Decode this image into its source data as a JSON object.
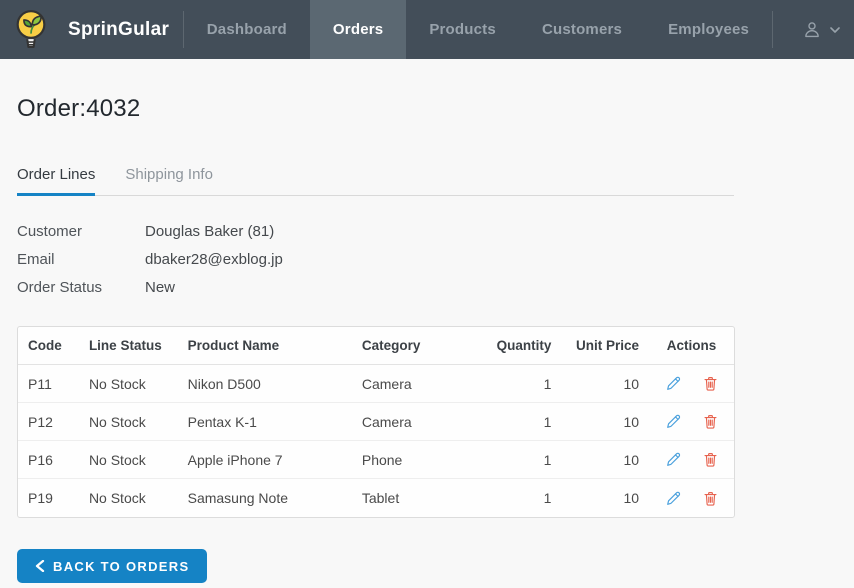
{
  "colors": {
    "navbar_bg": "#434e59",
    "navbar_active_bg": "#5b6872",
    "navbar_text": "#98a2ab",
    "navbar_active_text": "#fefefe",
    "primary": "#1583c5",
    "edit_icon": "#4ba1dd",
    "delete_icon": "#e7624e",
    "page_bg": "#f8f8f8",
    "table_bg": "#fefefe",
    "table_border": "#dcdcdc",
    "text": "#4a4a4a",
    "muted_text": "#8e959c",
    "heading_text": "#22282e"
  },
  "navbar": {
    "brand": "SprinGular",
    "logo_icon": "lightbulb-leaf-logo",
    "items": [
      {
        "label": "Dashboard",
        "active": false
      },
      {
        "label": "Orders",
        "active": true
      },
      {
        "label": "Products",
        "active": false
      },
      {
        "label": "Customers",
        "active": false
      },
      {
        "label": "Employees",
        "active": false
      }
    ],
    "user_menu_icon": "person-icon"
  },
  "page": {
    "title": "Order:4032"
  },
  "tabs": [
    {
      "label": "Order Lines",
      "active": true
    },
    {
      "label": "Shipping Info",
      "active": false
    }
  ],
  "details": [
    {
      "label": "Customer",
      "value": "Douglas Baker (81)"
    },
    {
      "label": "Email",
      "value": "dbaker28@exblog.jp"
    },
    {
      "label": "Order Status",
      "value": "New"
    }
  ],
  "table": {
    "headers": [
      "Code",
      "Line Status",
      "Product Name",
      "Category",
      "Quantity",
      "Unit Price",
      "Actions"
    ],
    "rows": [
      {
        "code": "P11",
        "line_status": "No Stock",
        "product_name": "Nikon D500",
        "category": "Camera",
        "quantity": "1",
        "unit_price": "10"
      },
      {
        "code": "P12",
        "line_status": "No Stock",
        "product_name": "Pentax K-1",
        "category": "Camera",
        "quantity": "1",
        "unit_price": "10"
      },
      {
        "code": "P16",
        "line_status": "No Stock",
        "product_name": "Apple iPhone 7",
        "category": "Phone",
        "quantity": "1",
        "unit_price": "10"
      },
      {
        "code": "P19",
        "line_status": "No Stock",
        "product_name": "Samasung Note",
        "category": "Tablet",
        "quantity": "1",
        "unit_price": "10"
      }
    ]
  },
  "footer": {
    "back_button_label": "BACK TO ORDERS"
  }
}
